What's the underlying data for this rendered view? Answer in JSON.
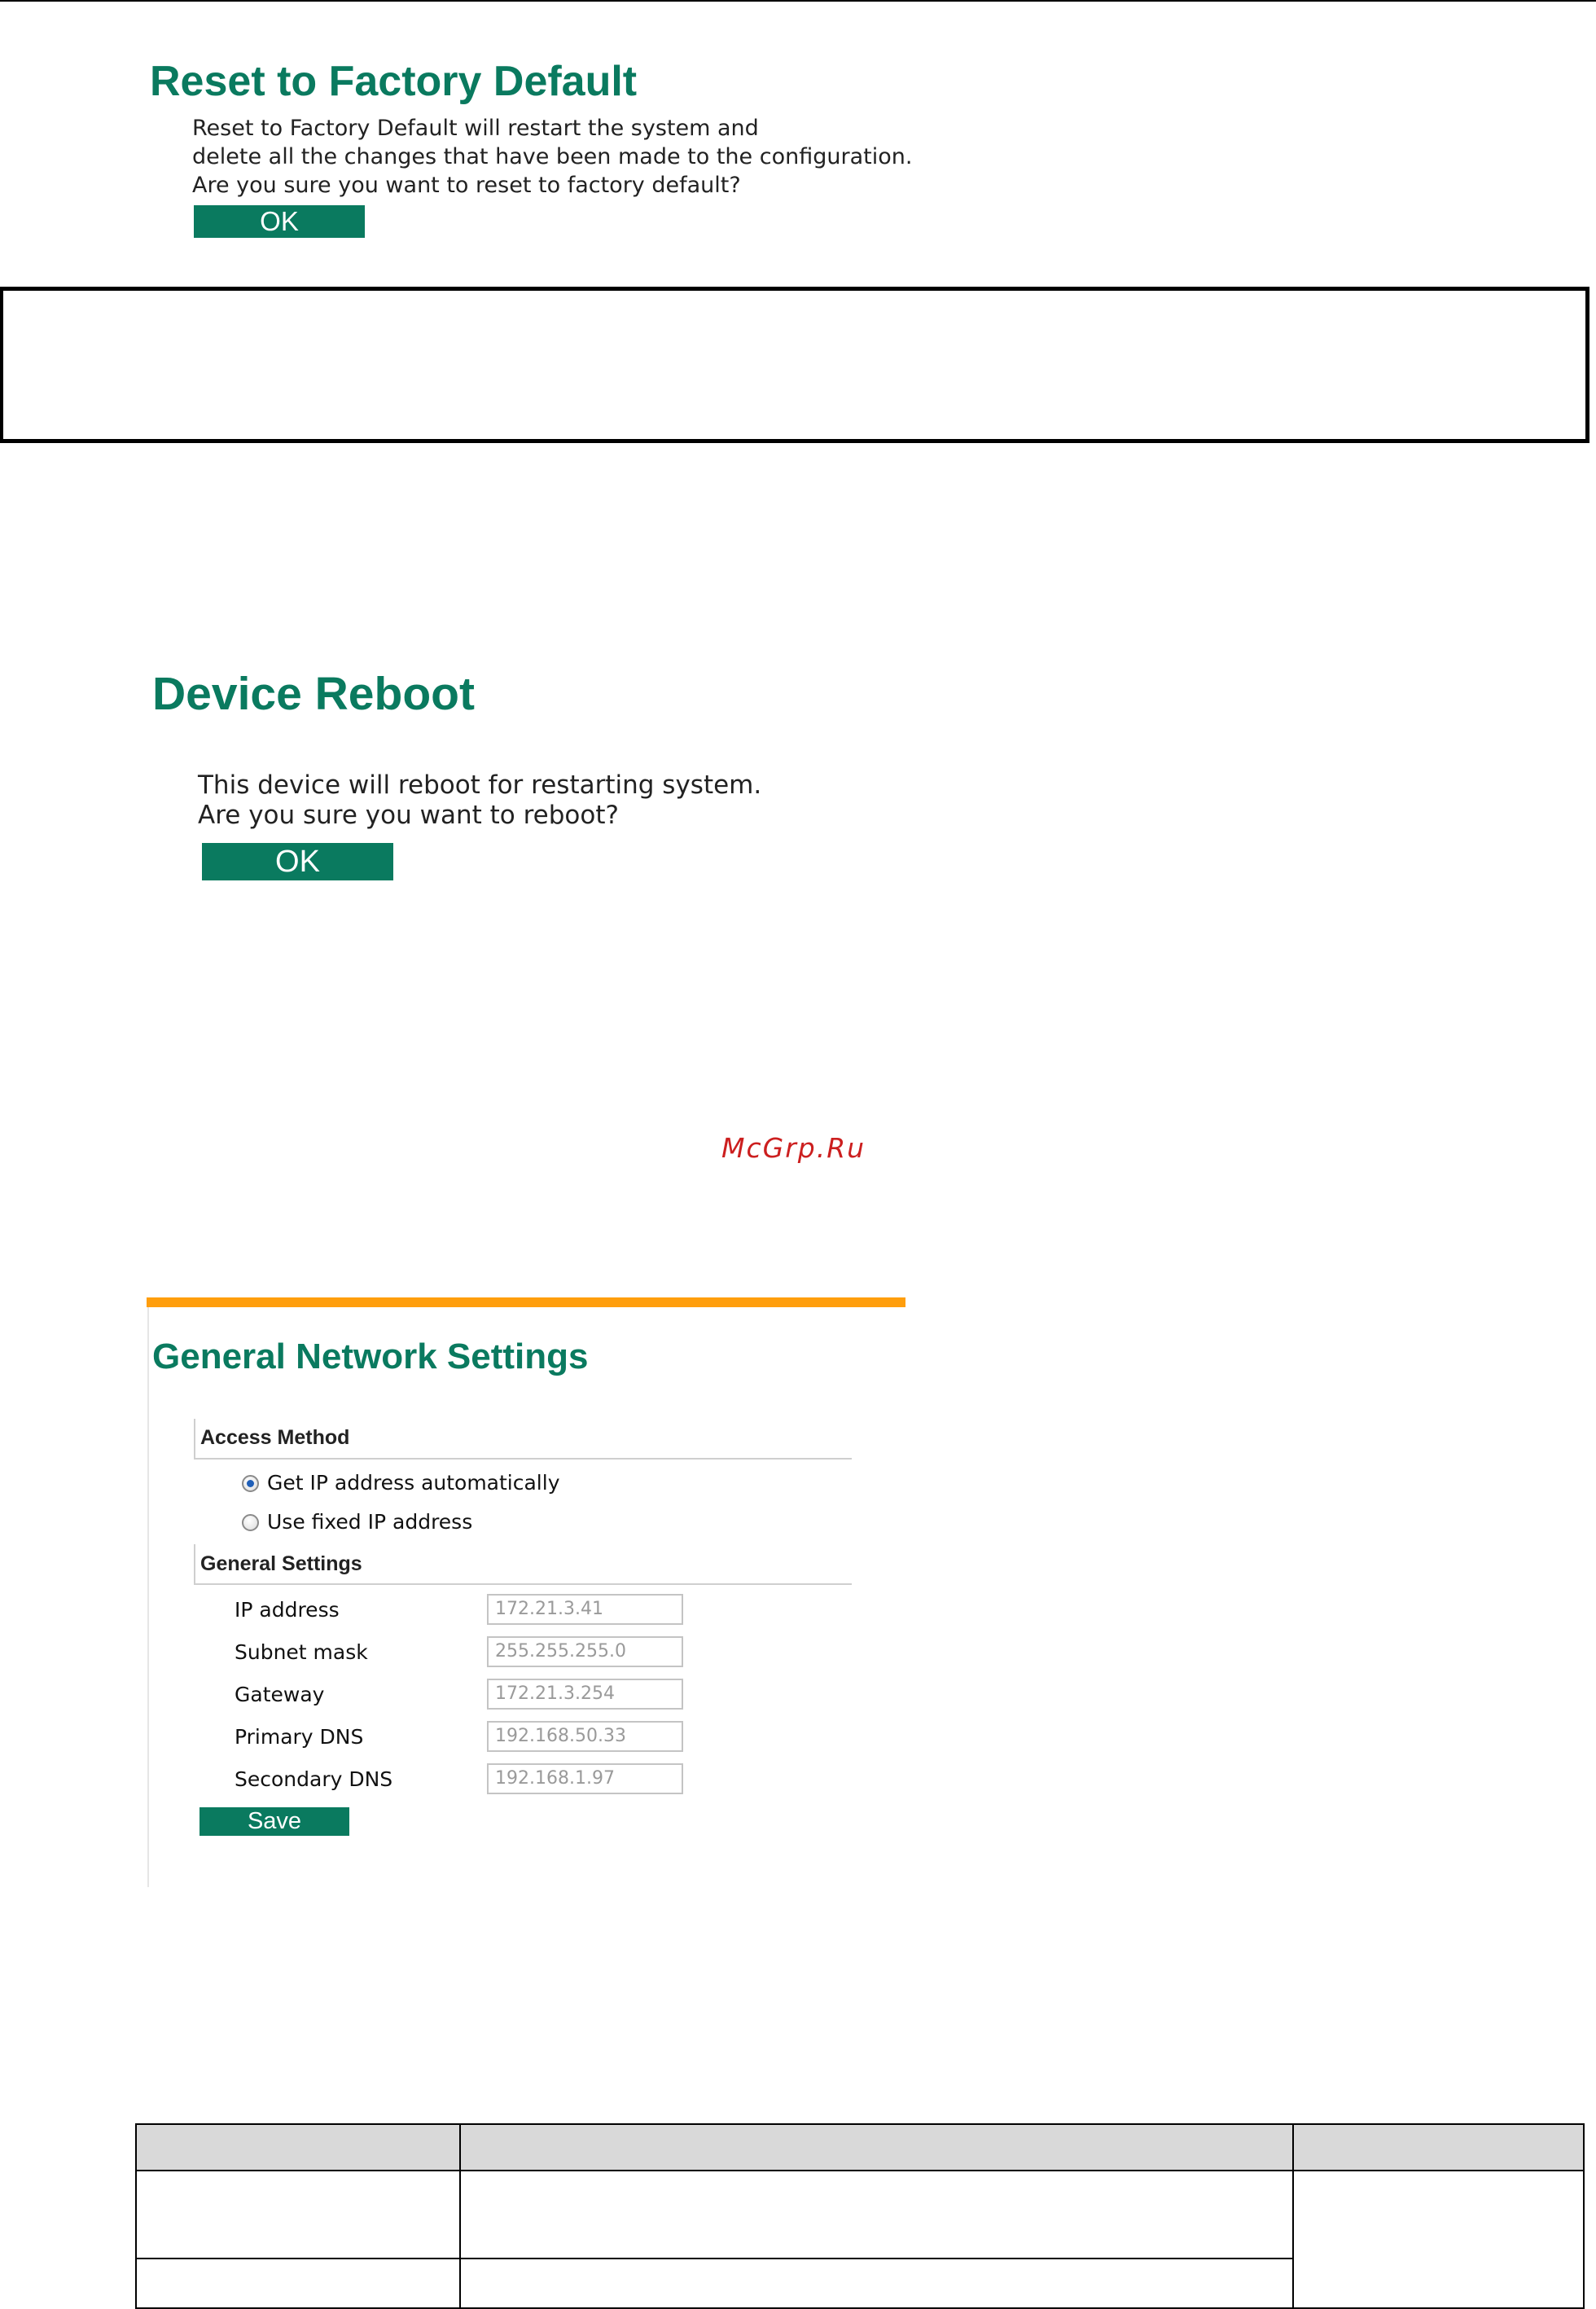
{
  "reset_factory": {
    "title": "Reset to Factory Default",
    "lines": [
      "Reset to Factory Default will restart the system and",
      "delete all the changes that have been made to the configuration.",
      "Are you sure you want to reset to factory default?"
    ],
    "ok_label": "OK"
  },
  "device_reboot": {
    "title": "Device Reboot",
    "lines": [
      "This device will reboot for restarting system.",
      "Are you sure you want to reboot?"
    ],
    "ok_label": "OK"
  },
  "watermark": "McGrp.Ru",
  "network_settings": {
    "title": "General Network Settings",
    "access_method": {
      "header": "Access Method",
      "options": [
        {
          "label": "Get IP address automatically",
          "selected": true
        },
        {
          "label": "Use fixed IP address",
          "selected": false
        }
      ]
    },
    "general_settings": {
      "header": "General Settings",
      "fields": [
        {
          "label": "IP address",
          "value": "172.21.3.41"
        },
        {
          "label": "Subnet mask",
          "value": "255.255.255.0"
        },
        {
          "label": "Gateway",
          "value": "172.21.3.254"
        },
        {
          "label": "Primary DNS",
          "value": "192.168.50.33"
        },
        {
          "label": "Secondary DNS",
          "value": "192.168.1.97"
        }
      ]
    },
    "save_label": "Save"
  },
  "colors": {
    "accent_green": "#0a7a5f",
    "orange_bar": "#ff9e0d",
    "watermark_red": "#cc1f1f",
    "table_header": "#d9d9d9"
  }
}
